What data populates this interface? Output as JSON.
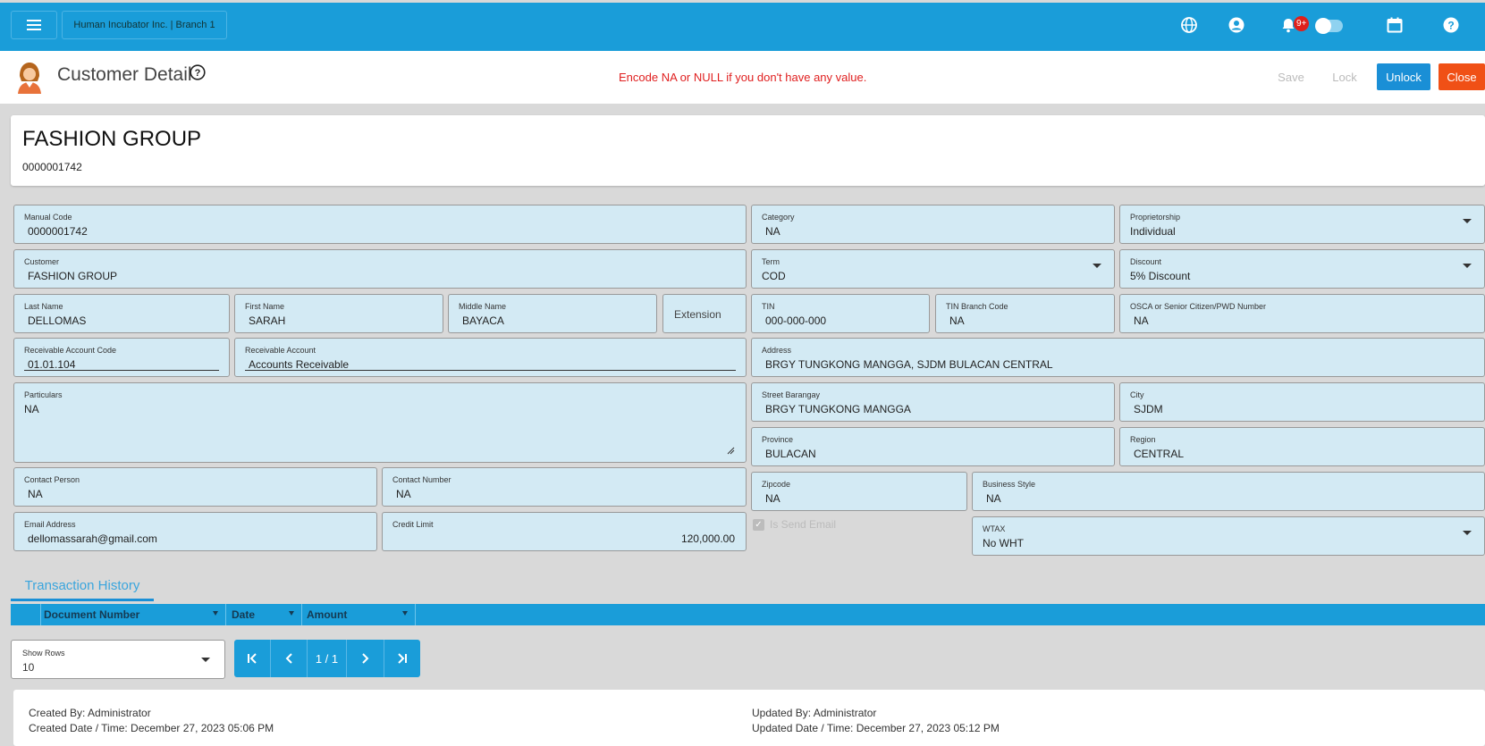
{
  "topbar": {
    "branch": "Human Incubator Inc. | Branch 1",
    "notification_count": "9+",
    "icons": [
      "menu-icon",
      "globe-icon",
      "user-circle-icon",
      "bell-icon",
      "moon-icon",
      "calendar-icon",
      "help-icon"
    ],
    "color": "#1a9dd9"
  },
  "header": {
    "title": "Customer Detail",
    "notice": "Encode NA or NULL if you don't have any value.",
    "save_label": "Save",
    "lock_label": "Lock",
    "unlock_label": "Unlock",
    "close_label": "Close"
  },
  "customer": {
    "name": "FASHION GROUP",
    "code": "0000001742"
  },
  "fields": {
    "manual_code": {
      "label": "Manual Code",
      "value": "0000001742"
    },
    "category": {
      "label": "Category",
      "value": "NA"
    },
    "proprietorship": {
      "label": "Proprietorship",
      "value": "Individual"
    },
    "customer": {
      "label": "Customer",
      "value": "FASHION GROUP"
    },
    "term": {
      "label": "Term",
      "value": "COD"
    },
    "discount": {
      "label": "Discount",
      "value": "5% Discount"
    },
    "last_name": {
      "label": "Last Name",
      "value": "DELLOMAS"
    },
    "first_name": {
      "label": "First Name",
      "value": "SARAH"
    },
    "middle_name": {
      "label": "Middle Name",
      "value": "BAYACA"
    },
    "extension": {
      "placeholder": "Extension"
    },
    "tin": {
      "label": "TIN",
      "value": "000-000-000"
    },
    "tin_branch": {
      "label": "TIN Branch Code",
      "value": "NA"
    },
    "osca": {
      "label": "OSCA or Senior Citizen/PWD Number",
      "value": "NA"
    },
    "receivable_code": {
      "label": "Receivable Account Code",
      "value": "01.01.104"
    },
    "receivable_account": {
      "label": "Receivable Account",
      "value": "Accounts Receivable"
    },
    "address": {
      "label": "Address",
      "value": "BRGY TUNGKONG MANGGA, SJDM BULACAN CENTRAL"
    },
    "particulars": {
      "label": "Particulars",
      "value": "NA"
    },
    "street_barangay": {
      "label": "Street Barangay",
      "value": "BRGY TUNGKONG MANGGA"
    },
    "city": {
      "label": "City",
      "value": "SJDM"
    },
    "province": {
      "label": "Province",
      "value": "BULACAN"
    },
    "region": {
      "label": "Region",
      "value": "CENTRAL"
    },
    "contact_person": {
      "label": "Contact Person",
      "value": "NA"
    },
    "contact_number": {
      "label": "Contact Number",
      "value": "NA"
    },
    "zipcode": {
      "label": "Zipcode",
      "value": "NA"
    },
    "business_style": {
      "label": "Business Style",
      "value": "NA"
    },
    "email": {
      "label": "Email Address",
      "value": "dellomassarah@gmail.com"
    },
    "credit_limit": {
      "label": "Credit Limit",
      "value": "120,000.00"
    },
    "send_email": {
      "label": "Is Send Email",
      "checked": true
    },
    "wtax": {
      "label": "WTAX",
      "value": "No WHT"
    }
  },
  "history": {
    "tab_label": "Transaction History",
    "columns": [
      "Document Number",
      "Date",
      "Amount"
    ],
    "rows_label": "Show Rows",
    "rows_value": "10",
    "page": "1 / 1"
  },
  "footer": {
    "created_by": "Created By: Administrator",
    "created_date": "Created Date / Time: December 27, 2023 05:06 PM",
    "updated_by": "Updated By: Administrator",
    "updated_date": "Updated Date / Time: December 27, 2023 05:12 PM"
  }
}
